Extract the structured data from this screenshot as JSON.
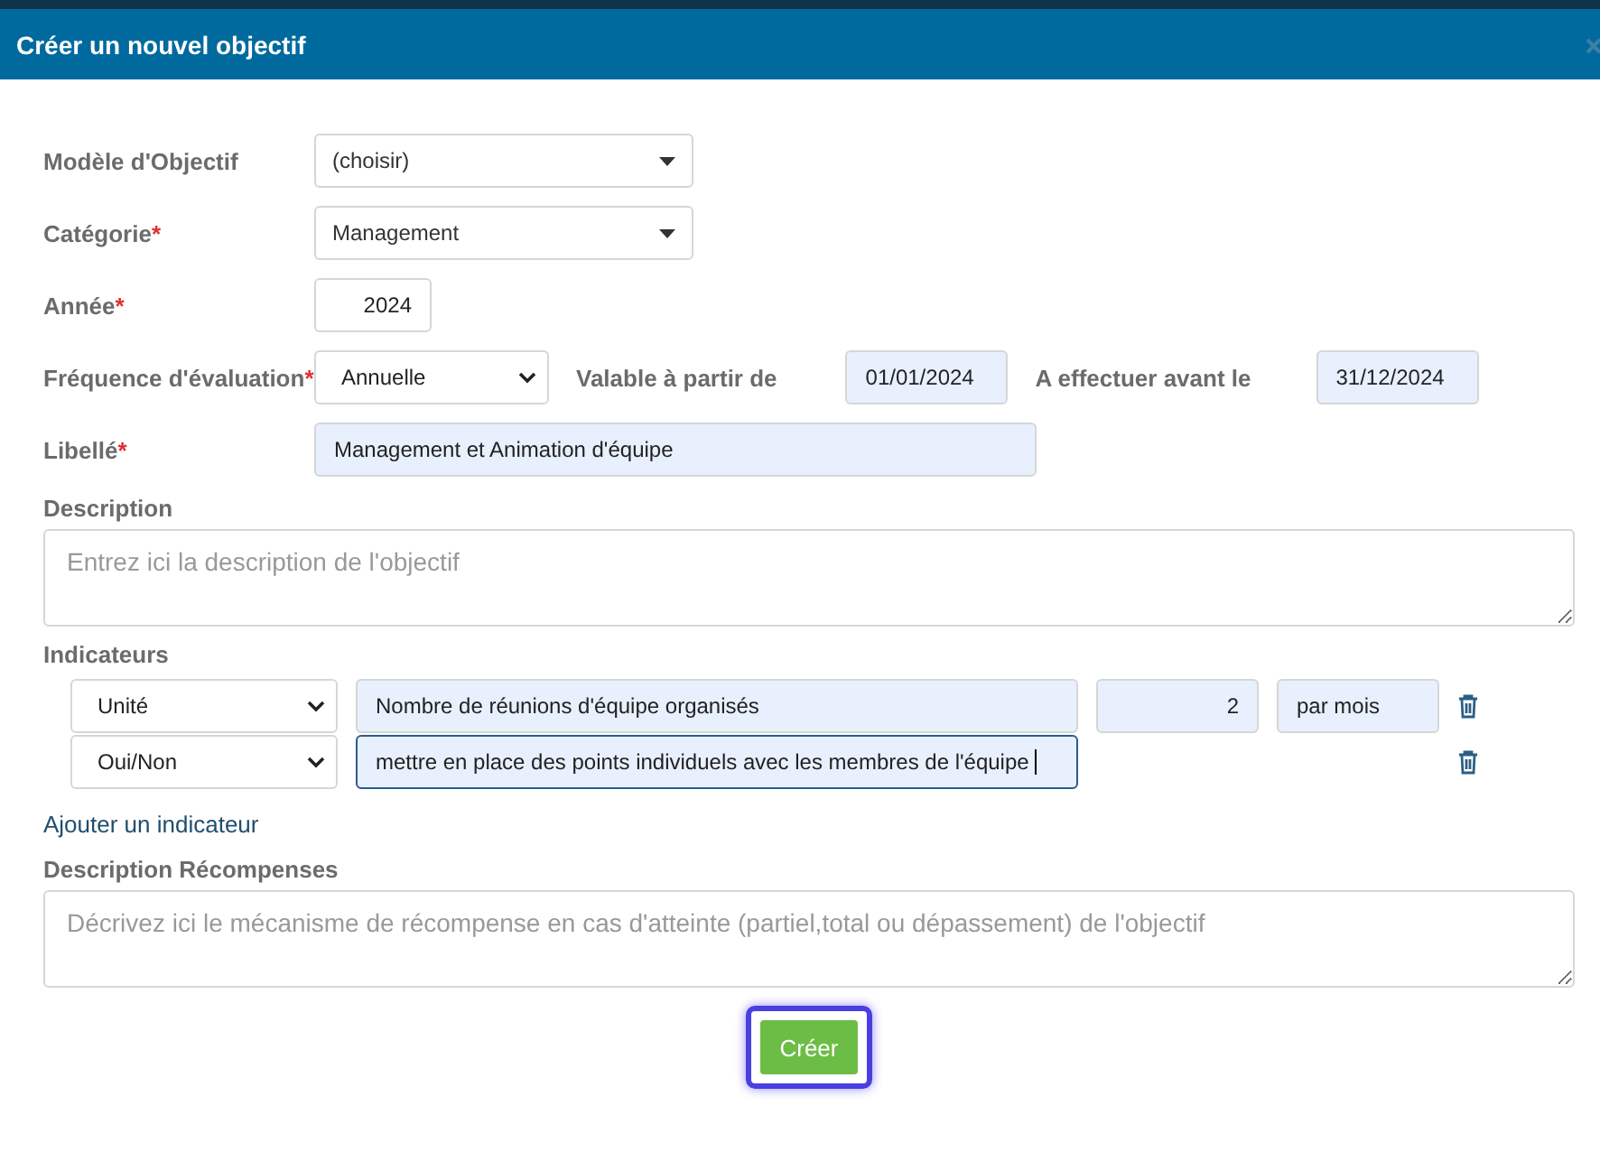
{
  "dialog": {
    "title": "Créer un nouvel objectif"
  },
  "fields": {
    "model": {
      "label": "Modèle d'Objectif",
      "value": "(choisir)"
    },
    "category": {
      "label": "Catégorie",
      "required_mark": "*",
      "value": "Management"
    },
    "year": {
      "label": "Année",
      "required_mark": "*",
      "value": "2024"
    },
    "frequency": {
      "label": "Fréquence d'évaluation",
      "required_mark": "*",
      "value": "Annuelle"
    },
    "valid_from": {
      "label": "Valable à partir de",
      "value": "01/01/2024"
    },
    "due_before": {
      "label": "A effectuer avant le",
      "value": "31/12/2024"
    },
    "title": {
      "label": "Libellé",
      "required_mark": "*",
      "value": "Management et Animation d'équipe"
    },
    "description": {
      "label": "Description",
      "placeholder": "Entrez ici la description de l'objectif"
    }
  },
  "indicators": {
    "label": "Indicateurs",
    "items": [
      {
        "type": "Unité",
        "name": "Nombre de réunions d'équipe organisés",
        "target": "2",
        "unit": "par mois",
        "focused": false
      },
      {
        "type": "Oui/Non",
        "name": "mettre en place des points individuels avec les membres de l'équipe",
        "focused": true
      }
    ],
    "add_link": "Ajouter un indicateur"
  },
  "rewards": {
    "label": "Description Récompenses",
    "placeholder": "Décrivez ici le mécanisme de récompense en cas d'atteinte (partiel,total ou dépassement) de l'objectif"
  },
  "submit": {
    "label": "Créer",
    "focused": true
  }
}
